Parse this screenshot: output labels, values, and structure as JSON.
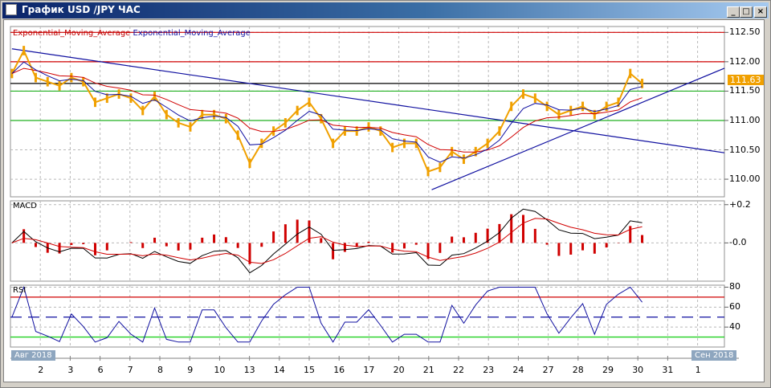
{
  "window": {
    "title": "График USD /JPY  ЧАС",
    "buttons": [
      "_",
      "□",
      "×"
    ]
  },
  "legend": {
    "ema1": "Exponential_Moving_Average",
    "ema2": "Exponential_Moving_Average"
  },
  "macd_label": "MACD",
  "rsi_label": "RSI",
  "current_price": "111.63",
  "month_labels": {
    "start": "Авг 2018",
    "end": "Сен 2018"
  },
  "colors": {
    "price": "#f0a000",
    "ema_fast": "#1010a0",
    "ema_slow": "#d00000",
    "rsi": "#1010a0"
  },
  "chart_data": [
    {
      "type": "line",
      "title": "USD/JPY hourly",
      "ylim": [
        109.7,
        112.6
      ],
      "yticks": [
        "112.50",
        "112.00",
        "111.50",
        "111.00",
        "110.50",
        "110.00"
      ],
      "ytick_values": [
        112.5,
        112.0,
        111.5,
        111.0,
        110.5,
        110.0
      ],
      "xlim": [
        0,
        23.9
      ],
      "xticks": [
        "2",
        "3",
        "6",
        "7",
        "8",
        "9",
        "10",
        "13",
        "14",
        "15",
        "16",
        "17",
        "20",
        "21",
        "22",
        "23",
        "24",
        "27",
        "28",
        "29",
        "30",
        "31",
        "1"
      ],
      "price_start_x": 0.05,
      "price_step_x": 0.398,
      "price": [
        111.8,
        112.19,
        111.73,
        111.66,
        111.59,
        111.73,
        111.66,
        111.31,
        111.38,
        111.45,
        111.38,
        111.17,
        111.41,
        111.1,
        110.96,
        110.89,
        111.1,
        111.1,
        111.03,
        110.75,
        110.27,
        110.61,
        110.82,
        110.96,
        111.17,
        111.31,
        111.03,
        110.61,
        110.82,
        110.82,
        110.89,
        110.82,
        110.54,
        110.61,
        110.61,
        110.13,
        110.2,
        110.47,
        110.34,
        110.47,
        110.61,
        110.82,
        111.24,
        111.45,
        111.38,
        111.24,
        111.1,
        111.17,
        111.24,
        111.1,
        111.24,
        111.31,
        111.8,
        111.63
      ],
      "hlines": [
        {
          "value": 112.5,
          "color": "#d00000"
        },
        {
          "value": 112.0,
          "color": "#d00000"
        },
        {
          "value": 111.63,
          "color": "#000000"
        },
        {
          "value": 111.5,
          "color": "#20b020"
        },
        {
          "value": 111.0,
          "color": "#20b020"
        }
      ],
      "trendlines": [
        {
          "x1": 0.05,
          "y1": 112.22,
          "x2": 23.9,
          "y2": 110.45,
          "color": "#1010a0"
        },
        {
          "x1": 14.1,
          "y1": 109.82,
          "x2": 23.9,
          "y2": 111.89,
          "color": "#1010a0"
        }
      ],
      "series": [
        {
          "name": "Exponential_Moving_Average",
          "period": 3
        },
        {
          "name": "Exponential_Moving_Average",
          "period": 8
        }
      ]
    },
    {
      "type": "bar",
      "title": "MACD",
      "yticks": [
        "+0.2",
        "-0.0"
      ],
      "ytick_values": [
        0.2,
        0.0
      ],
      "ylim": [
        -0.2,
        0.22
      ]
    },
    {
      "type": "line",
      "title": "RSI",
      "yticks": [
        "80",
        "60",
        "40"
      ],
      "ytick_values": [
        80,
        60,
        40
      ],
      "ylim": [
        20,
        82
      ],
      "levels": [
        {
          "value": 70,
          "color": "#d00000"
        },
        {
          "value": 50,
          "color": "#1010a0"
        },
        {
          "value": 30,
          "color": "#20d020"
        }
      ]
    }
  ]
}
